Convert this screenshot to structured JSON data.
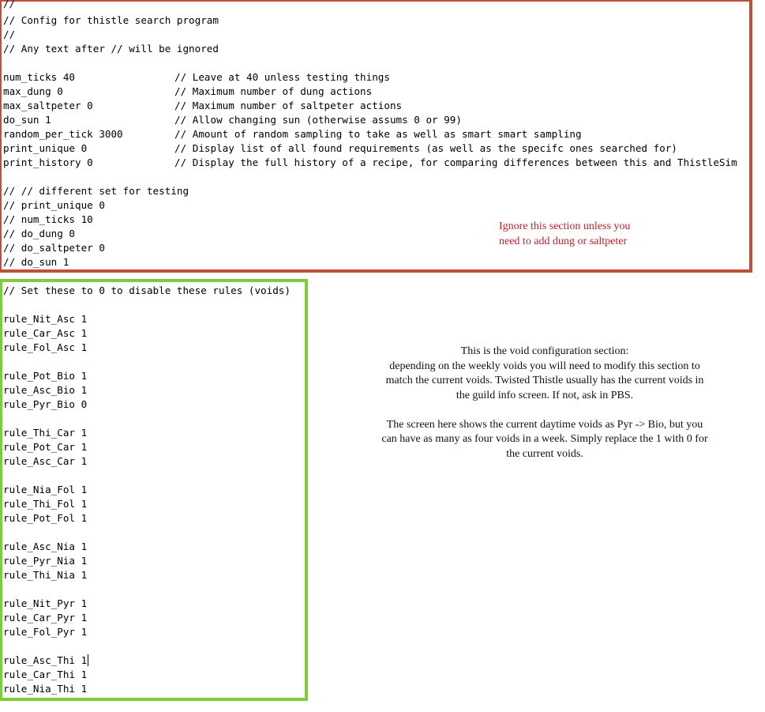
{
  "header_comments": [
    "//",
    "// Config for thistle search program",
    "//",
    "// Any text after // will be ignored"
  ],
  "settings": [
    {
      "code": "num_ticks 40",
      "comment": "// Leave at 40 unless testing things"
    },
    {
      "code": "max_dung 0",
      "comment": "// Maximum number of dung actions"
    },
    {
      "code": "max_saltpeter 0",
      "comment": "// Maximum number of saltpeter actions"
    },
    {
      "code": "do_sun 1",
      "comment": "// Allow changing sun (otherwise assums 0 or 99)"
    },
    {
      "code": "random_per_tick 3000",
      "comment": "// Amount of random sampling to take as well as smart smart sampling"
    },
    {
      "code": "print_unique 0",
      "comment": "// Display list of all found requirements (as well as the specifc ones searched for)"
    },
    {
      "code": "print_history 0",
      "comment": "// Display the full history of a recipe, for comparing differences between this and ThistleSim"
    }
  ],
  "testing_set": [
    "// // different set for testing",
    "// print_unique 0",
    "// num_ticks 10",
    "// do_dung 0",
    "// do_saltpeter 0",
    "// do_sun 1"
  ],
  "top_note": {
    "lines": [
      "Ignore this section unless you",
      "need to add dung or saltpeter"
    ],
    "color": "#c0202c"
  },
  "void_section": {
    "header": "// Set these to 0 to disable these rules (voids)",
    "groups": [
      [
        "rule_Nit_Asc 1",
        "rule_Car_Asc 1",
        "rule_Fol_Asc 1"
      ],
      [
        "rule_Pot_Bio 1",
        "rule_Asc_Bio 1",
        "rule_Pyr_Bio 0"
      ],
      [
        "rule_Thi_Car 1",
        "rule_Pot_Car 1",
        "rule_Asc_Car 1"
      ],
      [
        "rule_Nia_Fol 1",
        "rule_Thi_Fol 1",
        "rule_Pot_Fol 1"
      ],
      [
        "rule_Asc_Nia 1",
        "rule_Pyr_Nia 1",
        "rule_Thi_Nia 1"
      ],
      [
        "rule_Nit_Pyr 1",
        "rule_Car_Pyr 1",
        "rule_Fol_Pyr 1"
      ],
      [
        "rule_Asc_Thi 1",
        "rule_Car_Thi 1",
        "rule_Nia_Thi 1"
      ]
    ]
  },
  "void_note": {
    "lines": [
      "This is the void configuration section:",
      "depending on the weekly voids you will need to modify this section to",
      "match the current voids.  Twisted Thistle usually has the current voids in",
      "the guild info screen.  If not, ask in PBS.",
      "",
      "The screen here shows the current daytime voids as Pyr -> Bio, but you",
      "can have as many as four voids in a week.  Simply replace the 1 with 0 for",
      "the current voids."
    ]
  },
  "colors": {
    "top_border": "#c0503a",
    "void_border": "#7ccc3b"
  }
}
